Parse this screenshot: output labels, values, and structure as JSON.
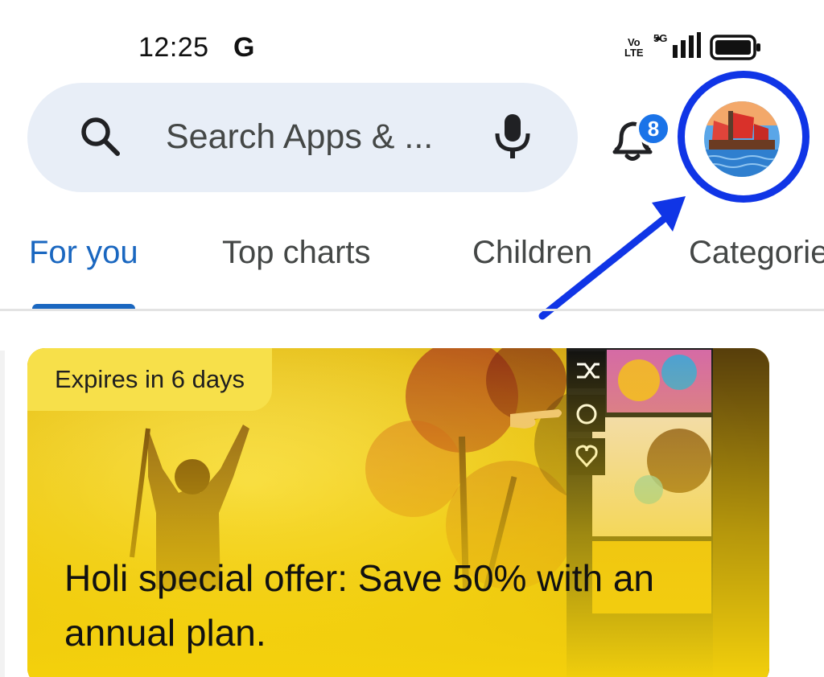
{
  "status_bar": {
    "time": "12:25",
    "g_logo": "G",
    "volte": [
      "Vo",
      "LTE"
    ],
    "network": "5G",
    "battery": "full"
  },
  "search": {
    "placeholder": "Search Apps & ...",
    "icon": "search-icon",
    "mic_icon": "mic-icon"
  },
  "notifications": {
    "icon": "bell-icon",
    "count": "8"
  },
  "profile": {
    "icon": "avatar",
    "annotation_color": "#1035e6"
  },
  "tabs": {
    "items": [
      {
        "label": "For you",
        "active": true
      },
      {
        "label": "Top charts",
        "active": false
      },
      {
        "label": "Children",
        "active": false
      },
      {
        "label": "Categories",
        "active": false
      }
    ]
  },
  "banner": {
    "expires": "Expires in 6 days",
    "title": "Holi special offer: Save 50% with an annual plan.",
    "accent": "#f5d20c"
  },
  "colors": {
    "tab_active": "#1a67c0",
    "badge": "#1a73e8",
    "search_bg": "#e8eef7"
  }
}
